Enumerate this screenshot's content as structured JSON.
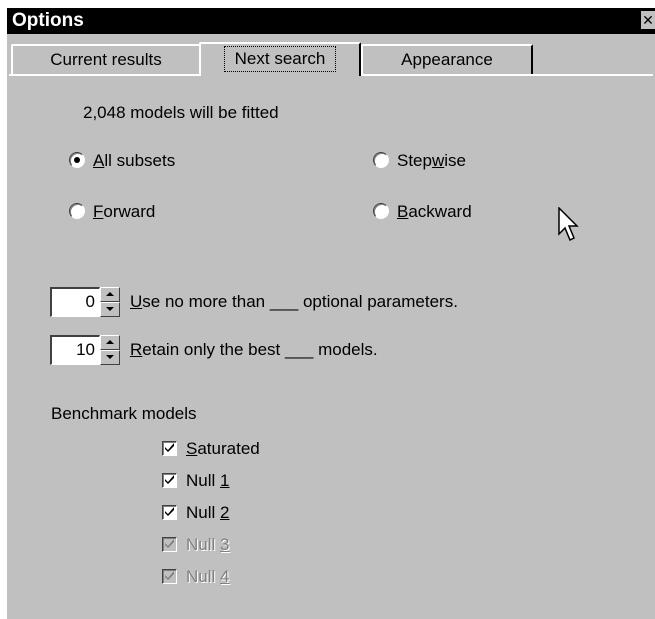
{
  "window": {
    "title": "Options",
    "close_glyph": "✕"
  },
  "tabs": [
    {
      "label": "Current results",
      "selected": false
    },
    {
      "label": "Next search",
      "selected": true
    },
    {
      "label": "Appearance",
      "selected": false
    }
  ],
  "next_search": {
    "models_count_text": "2,048 models will be fitted",
    "search_methods": [
      {
        "pre": "",
        "key": "A",
        "post": "ll subsets",
        "checked": true
      },
      {
        "pre": "Step",
        "key": "w",
        "post": "ise",
        "checked": false
      },
      {
        "pre": "",
        "key": "F",
        "post": "orward",
        "checked": false
      },
      {
        "pre": "",
        "key": "B",
        "post": "ackward",
        "checked": false
      }
    ],
    "optional_params": {
      "value": "0",
      "label_key": "U",
      "label_rest": "se no more than ___ optional parameters."
    },
    "retain_best": {
      "value": "10",
      "label_key": "R",
      "label_rest": "etain only the best ___ models."
    },
    "benchmark_heading": "Benchmark models",
    "benchmarks": [
      {
        "pre": "",
        "key": "S",
        "post": "aturated",
        "checked": true,
        "enabled": true
      },
      {
        "pre": "Null ",
        "key": "1",
        "post": "",
        "checked": true,
        "enabled": true
      },
      {
        "pre": "Null ",
        "key": "2",
        "post": "",
        "checked": true,
        "enabled": true
      },
      {
        "pre": "Null ",
        "key": "3",
        "post": "",
        "checked": true,
        "enabled": false
      },
      {
        "pre": "Null ",
        "key": "4",
        "post": "",
        "checked": true,
        "enabled": false
      }
    ]
  },
  "icons": {
    "cursor": "mouse-pointer-icon",
    "close": "close-icon"
  },
  "colors": {
    "face": "#c0c0c0",
    "titlebar": "#000000",
    "disabled_text": "#808080"
  }
}
